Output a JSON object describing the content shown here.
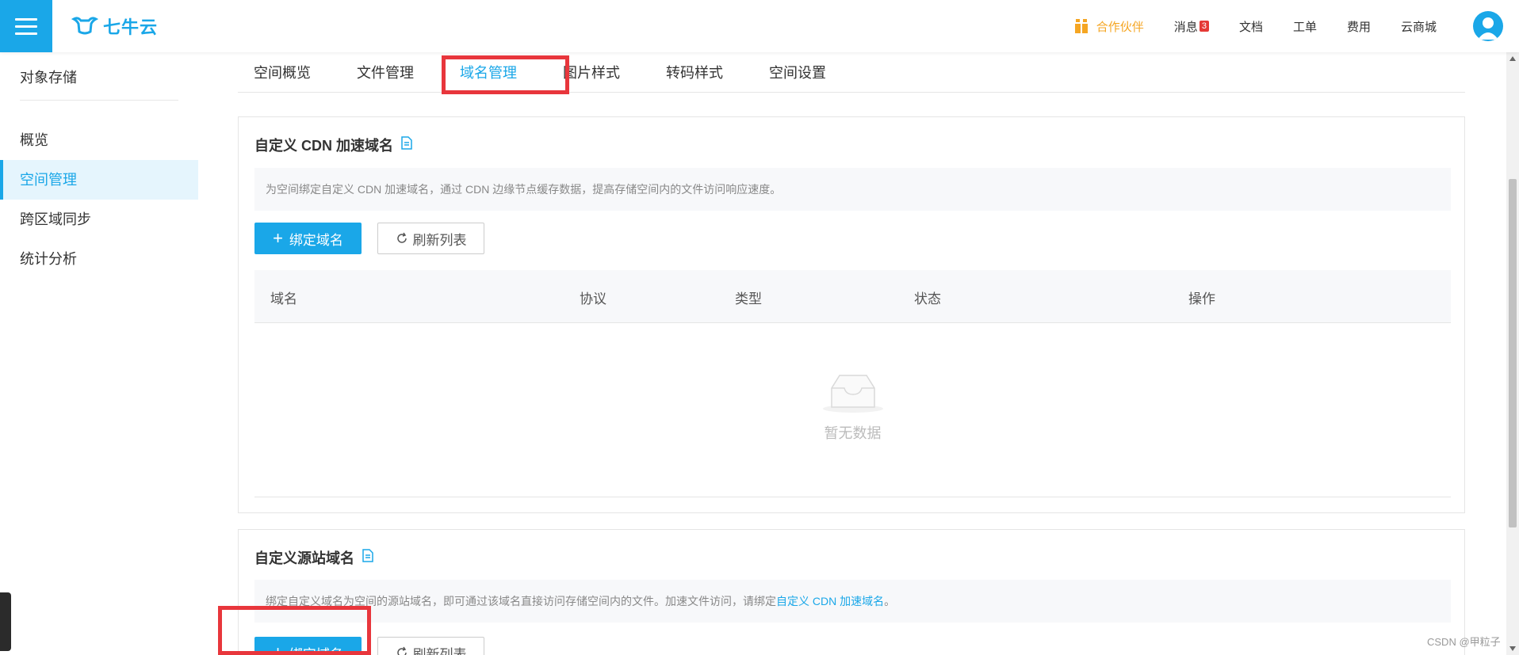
{
  "topbar": {
    "logo_text": "七牛云",
    "nav": {
      "partner": "合作伙伴",
      "messages": "消息",
      "messages_count": "3",
      "docs": "文档",
      "tickets": "工单",
      "billing": "费用",
      "market": "云商城"
    }
  },
  "sidebar": {
    "title": "对象存储",
    "items": [
      {
        "label": "概览"
      },
      {
        "label": "空间管理"
      },
      {
        "label": "跨区域同步"
      },
      {
        "label": "统计分析"
      }
    ]
  },
  "tabs": [
    {
      "label": "空间概览"
    },
    {
      "label": "文件管理"
    },
    {
      "label": "域名管理"
    },
    {
      "label": "图片样式"
    },
    {
      "label": "转码样式"
    },
    {
      "label": "空间设置"
    }
  ],
  "cdn_card": {
    "title": "自定义 CDN 加速域名",
    "info": "为空间绑定自定义 CDN 加速域名，通过 CDN 边缘节点缓存数据，提高存储空间内的文件访问响应速度。",
    "bind_button": "绑定域名",
    "refresh_button": "刷新列表",
    "columns": [
      "域名",
      "协议",
      "类型",
      "状态",
      "操作"
    ],
    "empty_text": "暂无数据"
  },
  "source_card": {
    "title": "自定义源站域名",
    "info_prefix": "绑定自定义域名为空间的源站域名，即可通过该域名直接访问存储空间内的文件。加速文件访问，请绑定",
    "info_link": "自定义 CDN 加速域名",
    "info_suffix": "。",
    "bind_button": "绑定域名",
    "refresh_button": "刷新列表"
  },
  "watermark": "CSDN @甲粒子",
  "colors": {
    "brand": "#1aa7e8",
    "highlight": "#e8363c",
    "partner": "#f5a623"
  }
}
